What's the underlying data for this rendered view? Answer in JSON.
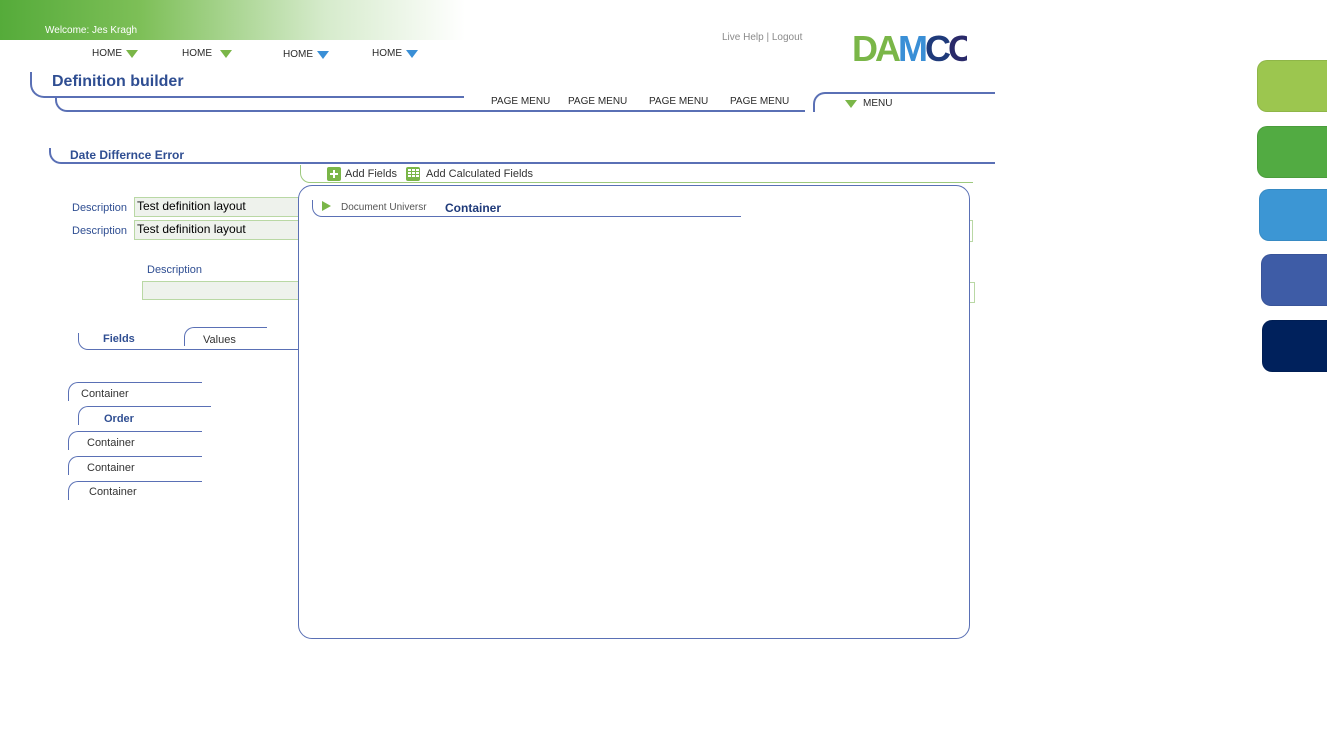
{
  "header": {
    "welcome": "Welcome: Jes Kragh",
    "nav": [
      {
        "label": "HOME",
        "arrow_color": "#7ab648"
      },
      {
        "label": "HOME",
        "arrow_color": "#7ab648"
      },
      {
        "label": "HOME",
        "arrow_color": "#3a8fd6"
      },
      {
        "label": "HOME",
        "arrow_color": "#3a8fd6"
      }
    ],
    "live_help": "Live Help",
    "separator": "|",
    "logout": "Logout",
    "logo_text": "DAMCO"
  },
  "title_bar": {
    "title": "Definition builder",
    "page_menus": [
      "PAGE MENU",
      "PAGE MENU",
      "PAGE MENU",
      "PAGE MENU"
    ],
    "menu_label": "MENU"
  },
  "section": {
    "title": "Date Differnce Error",
    "add_fields": "Add Fields",
    "add_calculated_fields": "Add Calculated Fields"
  },
  "form": {
    "description_label_1": "Description",
    "description_value_1": "Test definition layout",
    "description_label_2": "Description",
    "description_value_2": "Test definition layout",
    "description_label_3": "Description",
    "description_value_3": ""
  },
  "tabs": {
    "fields": "Fields",
    "values": "Values"
  },
  "left_list": {
    "items": [
      "Container",
      "Order",
      "Container",
      "Container",
      "Container"
    ]
  },
  "dialog": {
    "doc_label": "Document Universr",
    "container_label": "Container"
  },
  "side_tabs": {
    "colors": [
      "#9cc64f",
      "#52ab42",
      "#3c96d4",
      "#3e5ca6",
      "#00215c"
    ]
  }
}
